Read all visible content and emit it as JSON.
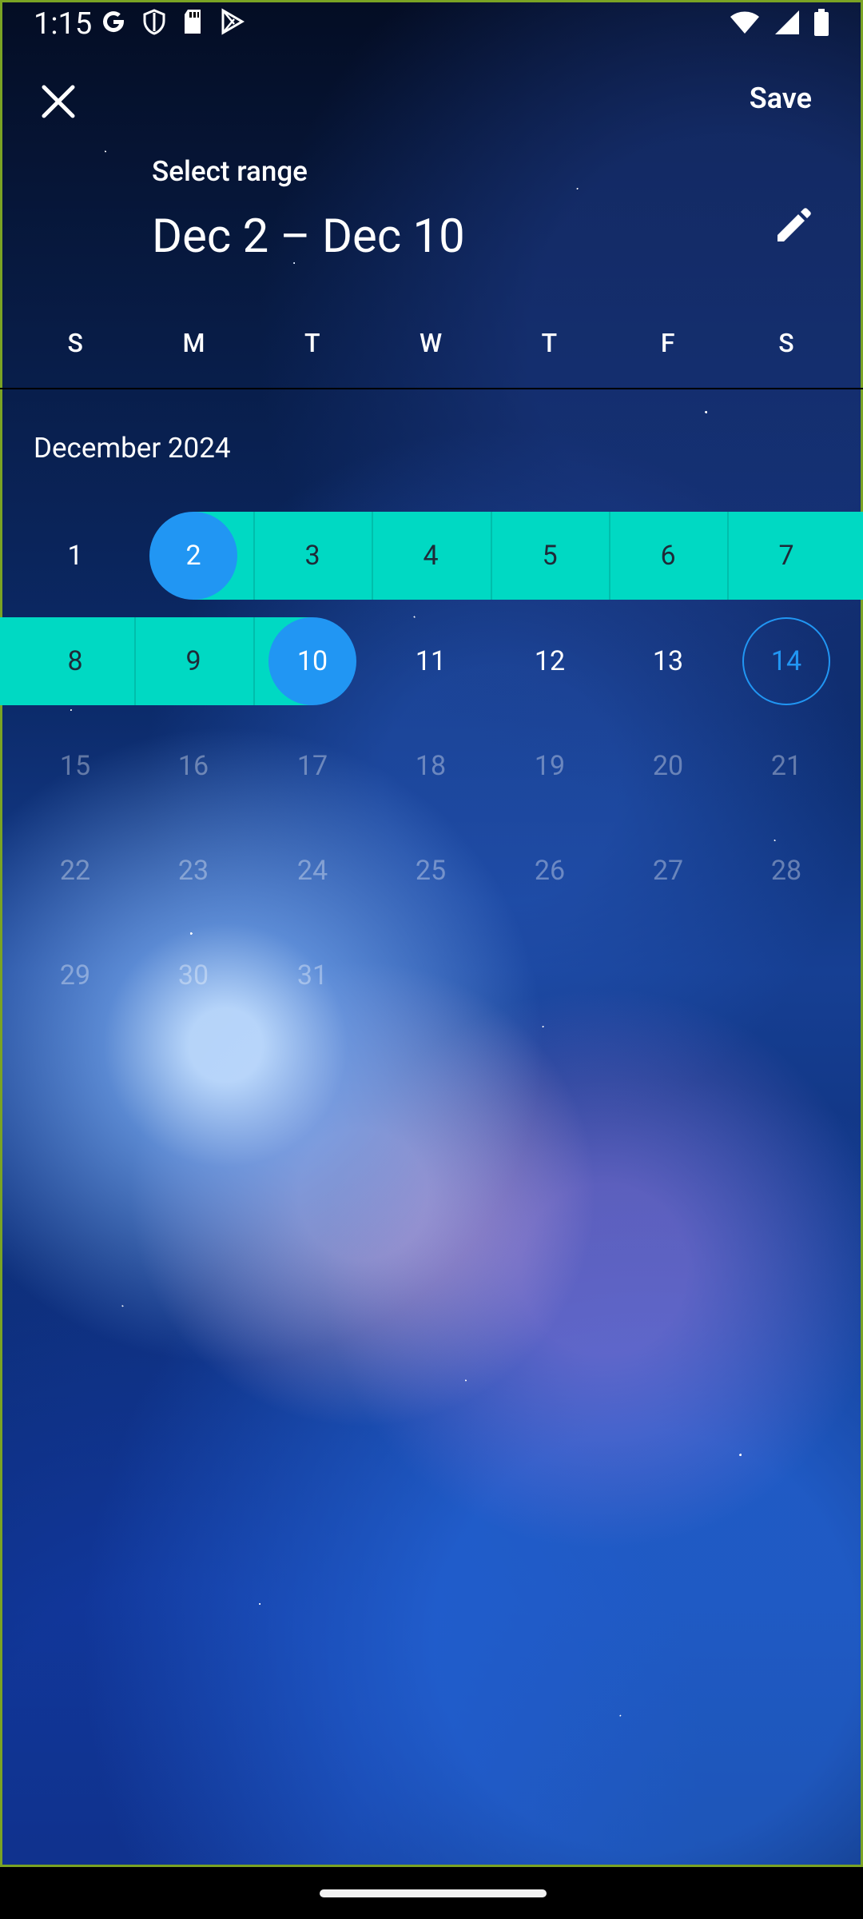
{
  "status_bar": {
    "time": "1:15",
    "icons_left": [
      "google-icon",
      "shield-icon",
      "sd-card-icon",
      "play-store-icon"
    ],
    "icons_right": [
      "wifi-icon",
      "cell-signal-icon",
      "battery-icon"
    ]
  },
  "header": {
    "close_icon": "close-icon",
    "save_label": "Save",
    "select_label": "Select range",
    "range_title": "Dec 2 – Dec 10",
    "edit_icon": "pencil-icon"
  },
  "weekdays": [
    "S",
    "M",
    "T",
    "W",
    "T",
    "F",
    "S"
  ],
  "month": {
    "label": "December 2024",
    "weeks": [
      [
        "1",
        "2",
        "3",
        "4",
        "5",
        "6",
        "7"
      ],
      [
        "8",
        "9",
        "10",
        "11",
        "12",
        "13",
        "14"
      ],
      [
        "15",
        "16",
        "17",
        "18",
        "19",
        "20",
        "21"
      ],
      [
        "22",
        "23",
        "24",
        "25",
        "26",
        "27",
        "28"
      ],
      [
        "29",
        "30",
        "31",
        "",
        "",
        "",
        ""
      ]
    ],
    "range_start": "2",
    "range_end": "10",
    "today": "14"
  },
  "colors": {
    "range_band": "#00d9c3",
    "selected": "#2196f3",
    "today_outline": "#2196f3"
  }
}
